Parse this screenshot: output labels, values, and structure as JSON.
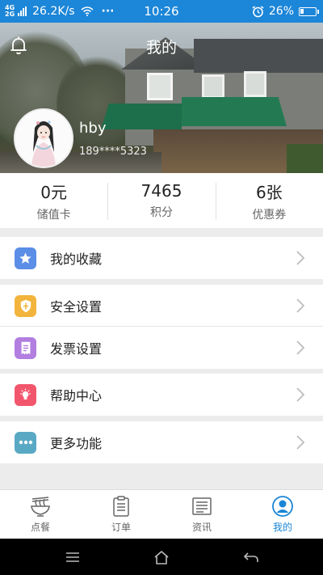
{
  "status_bar": {
    "network_type_top": "4G",
    "network_type_bottom": "2G",
    "speed": "26.2K/s",
    "more": "···",
    "time": "10:26",
    "battery": "26%",
    "battery_level": 0.26
  },
  "header": {
    "title": "我的",
    "username": "hby",
    "phone": "189****5323"
  },
  "stats": [
    {
      "value": "0元",
      "label": "储值卡"
    },
    {
      "value": "7465",
      "label": "积分"
    },
    {
      "value": "6张",
      "label": "优惠券"
    }
  ],
  "menu": [
    {
      "label": "我的收藏",
      "icon": "star-icon",
      "color": "#5b8ee6"
    },
    {
      "label": "安全设置",
      "icon": "shield-icon",
      "color": "#f2b43c"
    },
    {
      "label": "发票设置",
      "icon": "receipt-icon",
      "color": "#b27ee0"
    },
    {
      "label": "帮助中心",
      "icon": "lightbulb-icon",
      "color": "#f2566d"
    },
    {
      "label": "更多功能",
      "icon": "more-dots-icon",
      "color": "#5aa9c4"
    }
  ],
  "tabs": [
    {
      "label": "点餐",
      "icon": "noodle-bowl-icon"
    },
    {
      "label": "订单",
      "icon": "clipboard-icon"
    },
    {
      "label": "资讯",
      "icon": "newspaper-icon"
    },
    {
      "label": "我的",
      "icon": "user-circle-icon",
      "active": true
    }
  ],
  "colors": {
    "accent": "#1a85d6",
    "status_bar": "#1c86d8"
  }
}
